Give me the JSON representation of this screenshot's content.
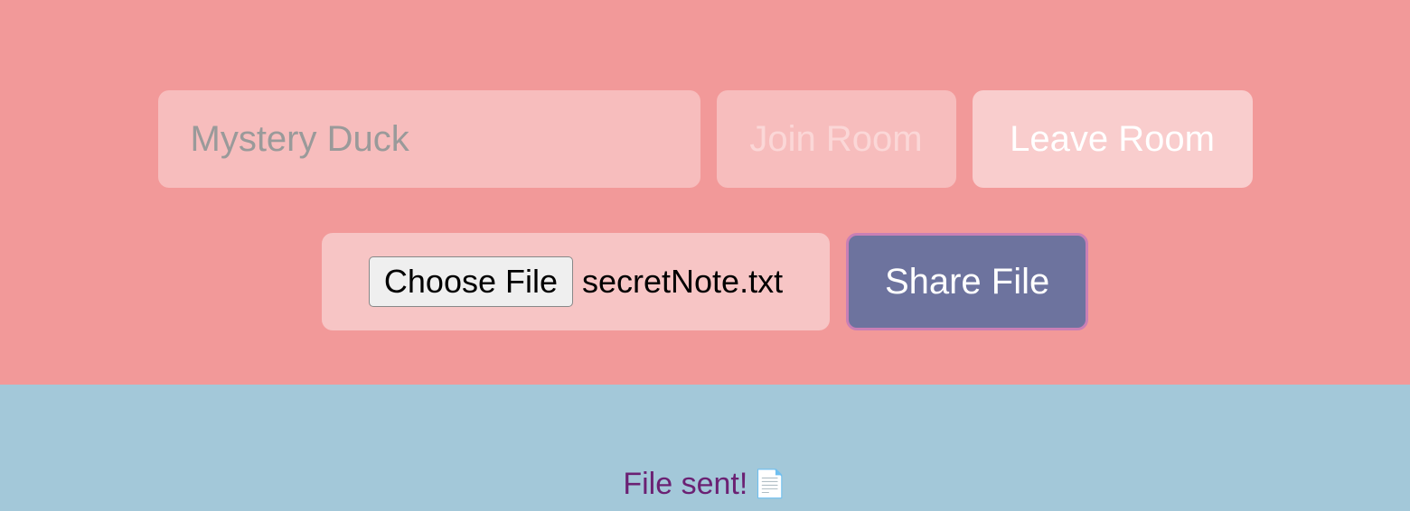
{
  "room": {
    "input_placeholder": "Mystery Duck",
    "input_value": "",
    "join_label": "Join Room",
    "leave_label": "Leave Room"
  },
  "file": {
    "choose_label": "Choose File",
    "selected_name": "secretNote.txt",
    "share_label": "Share File"
  },
  "status": {
    "message": "File sent!",
    "icon": "📄"
  },
  "colors": {
    "top_bg": "#f29999",
    "bottom_bg": "#a3c8d9",
    "share_btn": "#6d739e",
    "share_border": "#c97fb5",
    "status_text": "#6b2173"
  }
}
